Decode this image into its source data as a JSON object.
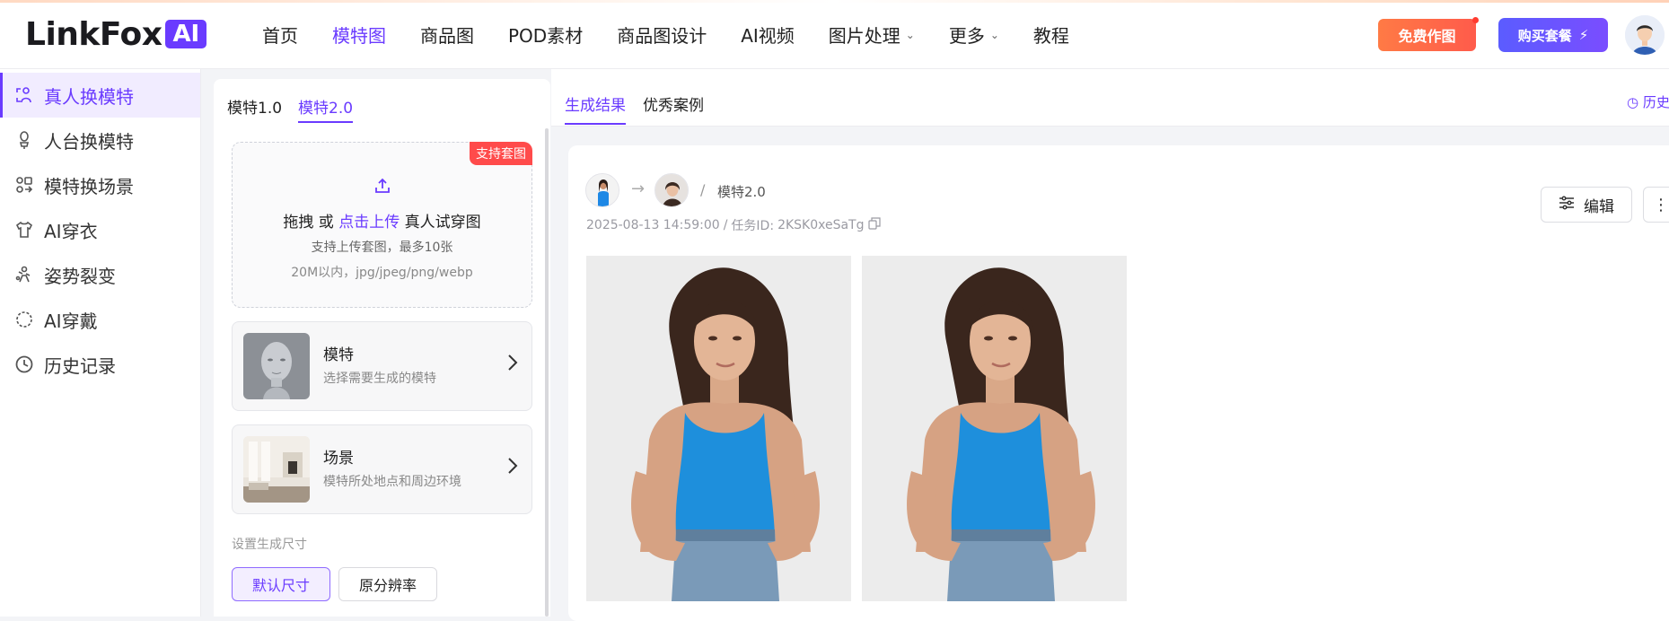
{
  "brand": {
    "name": "LinkFox",
    "badge": "AI"
  },
  "nav": {
    "items": [
      {
        "label": "首页",
        "dropdown": false,
        "active": false
      },
      {
        "label": "模特图",
        "dropdown": false,
        "active": true
      },
      {
        "label": "商品图",
        "dropdown": false,
        "active": false
      },
      {
        "label": "POD素材",
        "dropdown": false,
        "active": false
      },
      {
        "label": "商品图设计",
        "dropdown": false,
        "active": false
      },
      {
        "label": "AI视频",
        "dropdown": false,
        "active": false
      },
      {
        "label": "图片处理",
        "dropdown": true,
        "active": false
      },
      {
        "label": "更多",
        "dropdown": true,
        "active": false
      },
      {
        "label": "教程",
        "dropdown": false,
        "active": false
      }
    ],
    "free_button": "免费作图",
    "buy_button": "购买套餐",
    "buy_icon": "⚡"
  },
  "sidebar": {
    "items": [
      {
        "label": "真人换模特",
        "icon": "person-swap-icon",
        "active": true
      },
      {
        "label": "人台换模特",
        "icon": "mannequin-icon",
        "active": false
      },
      {
        "label": "模特换场景",
        "icon": "scene-swap-icon",
        "active": false
      },
      {
        "label": "AI穿衣",
        "icon": "shirt-icon",
        "active": false
      },
      {
        "label": "姿势裂变",
        "icon": "pose-icon",
        "active": false
      },
      {
        "label": "AI穿戴",
        "icon": "accessory-icon",
        "active": false
      },
      {
        "label": "历史记录",
        "icon": "clock-icon",
        "active": false
      }
    ]
  },
  "panel": {
    "model_tabs": [
      {
        "label": "模特1.0",
        "active": false
      },
      {
        "label": "模特2.0",
        "active": true
      }
    ],
    "upload": {
      "badge": "支持套图",
      "prefix": "拖拽 或 ",
      "link": "点击上传",
      "suffix": " 真人试穿图",
      "hint1": "支持上传套图，最多10张",
      "hint2": "20M以内，jpg/jpeg/png/webp"
    },
    "model_card": {
      "title": "模特",
      "subtitle": "选择需要生成的模特"
    },
    "scene_card": {
      "title": "场景",
      "subtitle": "模特所处地点和周边环境"
    },
    "size": {
      "label": "设置生成尺寸",
      "options": [
        {
          "label": "默认尺寸",
          "selected": true
        },
        {
          "label": "原分辨率",
          "selected": false
        }
      ]
    }
  },
  "results": {
    "tabs": [
      {
        "label": "生成结果",
        "active": true
      },
      {
        "label": "优秀案例",
        "active": false
      }
    ],
    "history_label": "历史",
    "task": {
      "model_version": "模特2.0",
      "timestamp": "2025-08-13 14:59:00",
      "task_id_label": "任务ID:",
      "task_id": "2KSK0xeSaTg",
      "edit_label": "编辑",
      "more_label": "⋮"
    }
  },
  "colors": {
    "accent": "#6a3bff",
    "free_btn": "#ff6a45",
    "badge_red": "#ff4b4b"
  }
}
